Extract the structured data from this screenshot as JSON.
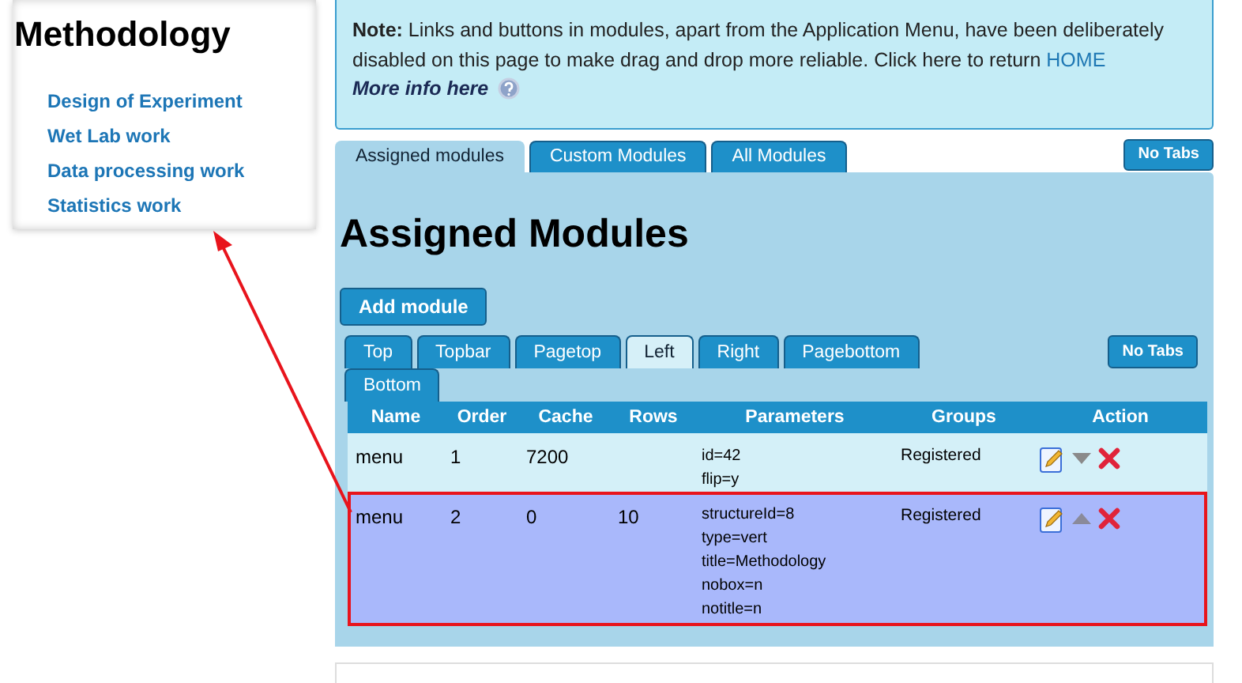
{
  "sidebar": {
    "title": "Methodology",
    "links": [
      "Design of Experiment",
      "Wet Lab work",
      "Data processing work",
      "Statistics work"
    ]
  },
  "note": {
    "text": "**Note:** Links and buttons in modules, apart from the Application Menu, have been deliberately disabled on this page to make drag and drop more reliable. Click here to return",
    "link": "HOME",
    "more_info": "More info here"
  },
  "main_tabs": [
    {
      "label": "Assigned modules",
      "selected": true
    },
    {
      "label": "Custom Modules",
      "selected": false
    },
    {
      "label": "All Modules",
      "selected": false
    }
  ],
  "no_tabs_button": "No Tabs",
  "heading": "Assigned Modules",
  "add_button": "Add module",
  "position_tabs": [
    {
      "label": "Top",
      "selected": false
    },
    {
      "label": "Topbar",
      "selected": false
    },
    {
      "label": "Pagetop",
      "selected": false
    },
    {
      "label": "Left",
      "selected": true
    },
    {
      "label": "Right",
      "selected": false
    },
    {
      "label": "Pagebottom",
      "selected": false
    },
    {
      "label": "Bottom",
      "selected": false
    }
  ],
  "position_no_tabs_button": "No Tabs",
  "table": {
    "columns": [
      "Name",
      "Order",
      "Cache",
      "Rows",
      "Parameters",
      "Groups",
      "Action"
    ],
    "rows": [
      {
        "name": "menu",
        "order": "1",
        "cache": "7200",
        "parameters": [
          "id=42",
          "flip=y"
        ],
        "groups": "Registered",
        "moves_up": false,
        "selected": false
      },
      {
        "name": "menu",
        "order": "2",
        "cache": "0",
        "rows": "10",
        "parameters": [
          "structureId=8",
          "type=vert",
          "title=Methodology",
          "nobox=n",
          "notitle=n"
        ],
        "groups": "Registered",
        "moves_up": true,
        "selected": true
      }
    ]
  }
}
